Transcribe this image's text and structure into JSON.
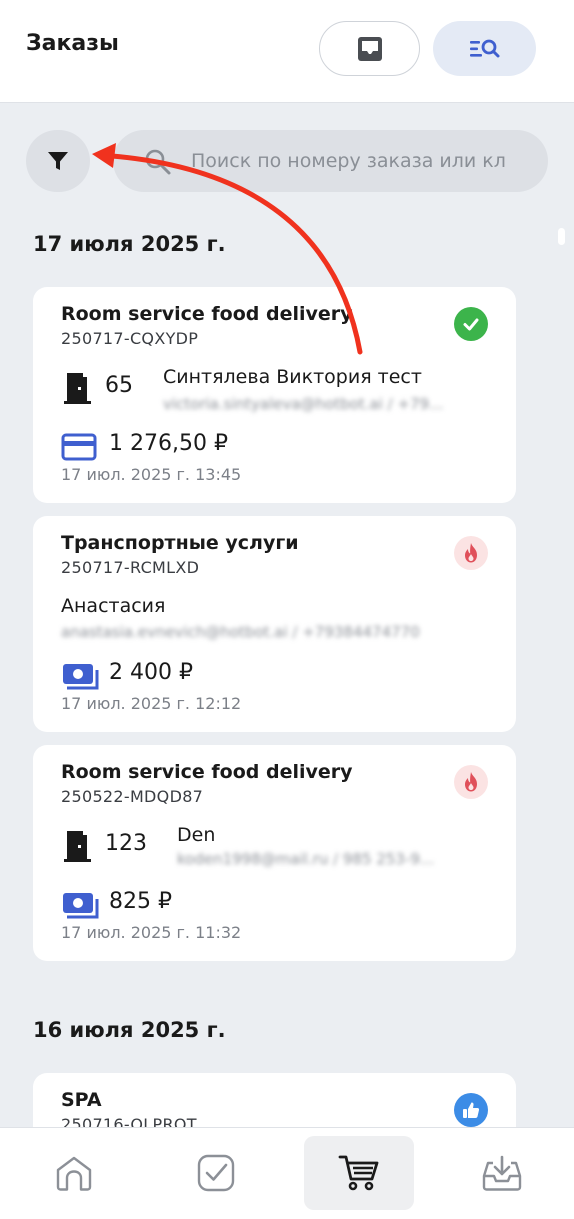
{
  "header": {
    "title": "Заказы"
  },
  "search": {
    "placeholder": "Поиск по номеру заказа или кл"
  },
  "colors": {
    "accent": "#3f5fcf",
    "done": "#3cb44b",
    "hot": "#e0505a",
    "like": "#3c8ce6",
    "arrow": "#f0321e"
  },
  "groups": [
    {
      "date": "17 июля 2025 г.",
      "orders": [
        {
          "title": "Room service food delivery",
          "id": "250717-CQXYDP",
          "status_icon": "check-circle-icon",
          "room": "65",
          "guest_name": "Синтялева Виктория тест",
          "guest_contact": "victoria.sintyaleva@hotbot.ai / +79...",
          "payment_icon": "card-icon",
          "amount": "1 276,50 ₽",
          "datetime": "17 июл. 2025 г. 13:45"
        },
        {
          "title": "Транспортные услуги",
          "id": "250717-RCMLXD",
          "status_icon": "fire-icon",
          "guest_name": "Анастасия",
          "guest_contact": "anastasia.evnevich@hotbot.ai / +79384474770",
          "payment_icon": "cash-icon",
          "amount": "2 400 ₽",
          "datetime": "17 июл. 2025 г. 12:12"
        },
        {
          "title": "Room service food delivery",
          "id": "250522-MDQD87",
          "status_icon": "fire-icon",
          "room": "123",
          "guest_name": "Den",
          "guest_contact": "koden1998@mail.ru / 985 253-9...",
          "payment_icon": "cash-icon",
          "amount": "825 ₽",
          "datetime": "17 июл. 2025 г. 11:32"
        }
      ]
    },
    {
      "date": "16 июля 2025 г.",
      "orders": [
        {
          "title": "SPA",
          "id": "250716-OLPROT",
          "status_icon": "thumbs-up-icon"
        }
      ]
    }
  ],
  "bottom_nav": [
    {
      "icon": "home-icon"
    },
    {
      "icon": "check-square-icon"
    },
    {
      "icon": "cart-icon",
      "active": true
    },
    {
      "icon": "inbox-download-icon"
    }
  ]
}
